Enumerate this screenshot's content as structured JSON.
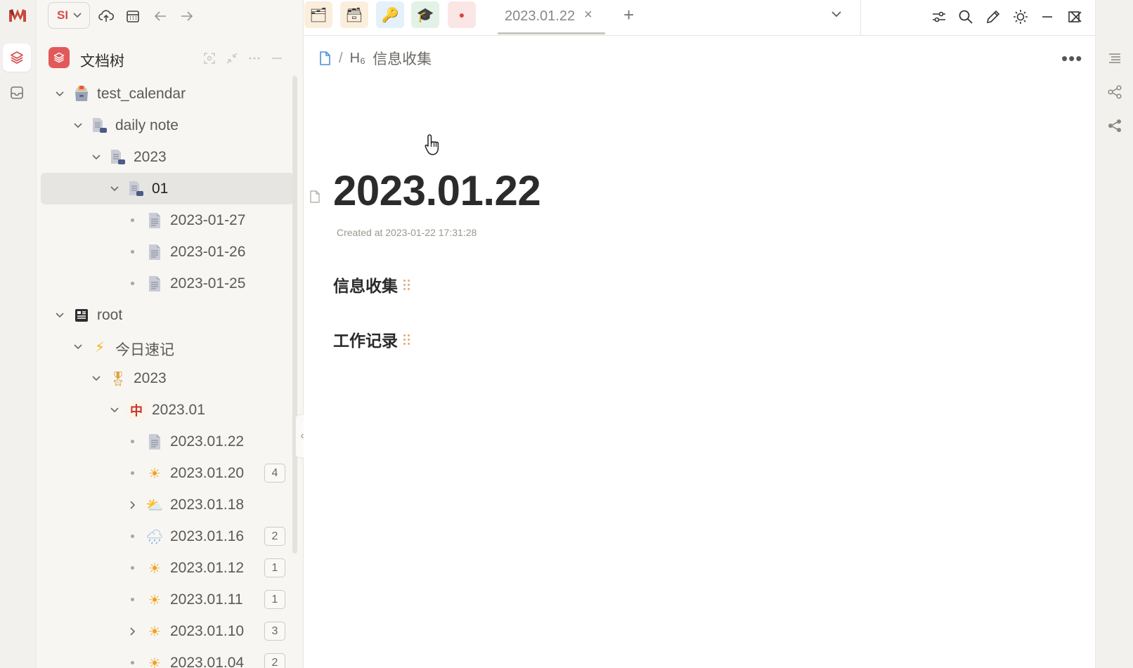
{
  "notebook_switch": {
    "label": "SI"
  },
  "sidebar": {
    "title": "文档树",
    "tree": [
      {
        "label": "test_calendar",
        "depth": 0,
        "toggle": "expanded",
        "icon": "notebook-box-icon"
      },
      {
        "label": "daily note",
        "depth": 1,
        "toggle": "expanded",
        "icon": "doc-stack-icon"
      },
      {
        "label": "2023",
        "depth": 2,
        "toggle": "expanded",
        "icon": "doc-stack-icon"
      },
      {
        "label": "01",
        "depth": 3,
        "toggle": "expanded",
        "icon": "doc-stack-icon",
        "selected": true
      },
      {
        "label": "2023-01-27",
        "depth": 4,
        "toggle": "leaf",
        "icon": "document-icon"
      },
      {
        "label": "2023-01-26",
        "depth": 4,
        "toggle": "leaf",
        "icon": "document-icon"
      },
      {
        "label": "2023-01-25",
        "depth": 4,
        "toggle": "leaf",
        "icon": "document-icon"
      },
      {
        "label": "root",
        "depth": 0,
        "toggle": "expanded",
        "icon": "newspaper-icon"
      },
      {
        "label": "今日速记",
        "depth": 1,
        "toggle": "expanded",
        "icon": "lightning-icon",
        "glyph": "⚡"
      },
      {
        "label": "2023",
        "depth": 2,
        "toggle": "expanded",
        "icon": "medal-icon",
        "glyph": "🎖"
      },
      {
        "label": "2023.01",
        "depth": 3,
        "toggle": "expanded",
        "icon": "mahjong-red-dragon-icon",
        "glyph": "中"
      },
      {
        "label": "2023.01.22",
        "depth": 4,
        "toggle": "leaf",
        "icon": "document-icon"
      },
      {
        "label": "2023.01.20",
        "depth": 4,
        "toggle": "leaf",
        "icon": "sun-icon",
        "glyph": "☀",
        "badge": "4"
      },
      {
        "label": "2023.01.18",
        "depth": 4,
        "toggle": "collapsed",
        "icon": "sun-behind-cloud-icon",
        "glyph": "⛅"
      },
      {
        "label": "2023.01.16",
        "depth": 4,
        "toggle": "leaf",
        "icon": "rain-cloud-icon",
        "glyph": "🌧",
        "badge": "2"
      },
      {
        "label": "2023.01.12",
        "depth": 4,
        "toggle": "leaf",
        "icon": "sun-icon",
        "glyph": "☀",
        "badge": "1"
      },
      {
        "label": "2023.01.11",
        "depth": 4,
        "toggle": "leaf",
        "icon": "sun-icon",
        "glyph": "☀",
        "badge": "1"
      },
      {
        "label": "2023.01.10",
        "depth": 4,
        "toggle": "collapsed",
        "icon": "sun-icon",
        "glyph": "☀",
        "badge": "3"
      },
      {
        "label": "2023.01.04",
        "depth": 4,
        "toggle": "leaf",
        "icon": "sun-icon",
        "glyph": "☀",
        "badge": "2"
      }
    ]
  },
  "tabs": {
    "pinned": [
      {
        "icon": "folder-icon",
        "glyph": "🗂",
        "bg": "#fbeedd"
      },
      {
        "icon": "card-box-icon",
        "glyph": "🗃",
        "bg": "#fbeedd"
      },
      {
        "icon": "key-icon",
        "glyph": "🔑",
        "bg": "#e4f0fa"
      },
      {
        "icon": "graduation-cap-icon",
        "glyph": "🎓",
        "bg": "#e3f2e6"
      },
      {
        "icon": "record-dot-icon",
        "glyph": "●",
        "bg": "#fbe6e6"
      }
    ],
    "active": {
      "label": "2023.01.22",
      "close": "×"
    },
    "add": "+"
  },
  "editor": {
    "breadcrumb": {
      "separator": "/",
      "heading_level": "H₆",
      "crumb": "信息收集"
    },
    "more": "•••",
    "title": "2023.01.22",
    "created": "Created at 2023-01-22 17:31:28",
    "headings": [
      "信息收集",
      "工作记录"
    ]
  },
  "colors": {
    "accent_red": "#e2595a",
    "sun_orange": "#f4a11a",
    "handle_orange": "#e3a873"
  }
}
